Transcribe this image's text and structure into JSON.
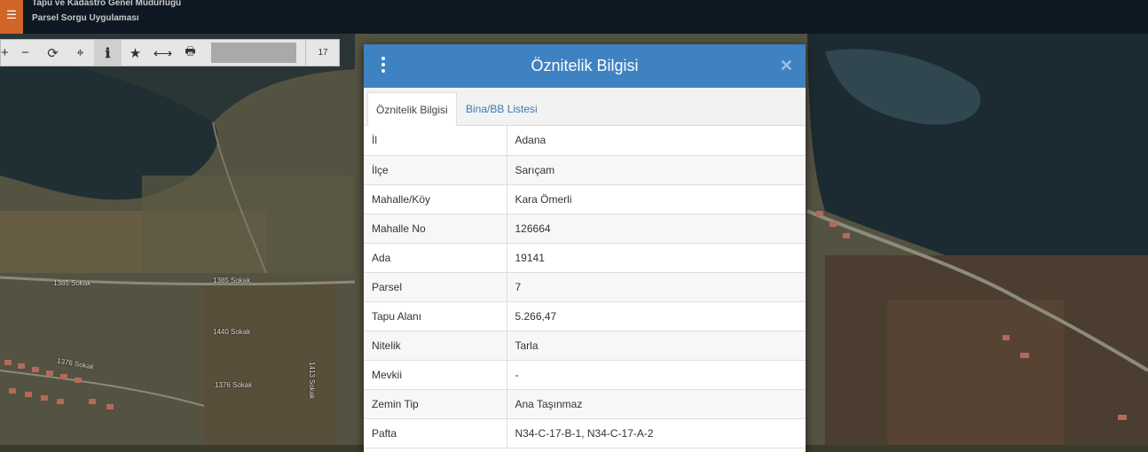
{
  "header": {
    "menu_icon": "hamburger-icon",
    "org_name": "Tapu ve Kadastro Genel Müdürlüğü",
    "app_name": "Parsel Sorgu Uygulaması"
  },
  "toolbar": {
    "tools": [
      {
        "name": "zoom-in-icon",
        "glyph": "+"
      },
      {
        "name": "zoom-out-icon",
        "glyph": "−"
      },
      {
        "name": "refresh-icon",
        "glyph": "⟳"
      },
      {
        "name": "locate-icon",
        "glyph": "⌖"
      },
      {
        "name": "info-icon",
        "glyph": "ℹ"
      },
      {
        "name": "star-icon",
        "glyph": "★"
      },
      {
        "name": "measure-icon",
        "glyph": "⟷"
      },
      {
        "name": "print-icon",
        "glyph": "🖶"
      }
    ],
    "zoom_level": "17"
  },
  "map": {
    "labels": [
      "1385 Sokak",
      "1385 Sokak",
      "1440 Sokak",
      "1376 Sokak",
      "1376 Sokak",
      "1413 Sokak"
    ]
  },
  "dialog": {
    "title": "Öznitelik Bilgisi",
    "close_icon": "close-icon",
    "tabs": [
      {
        "label": "Öznitelik Bilgisi",
        "active": true
      },
      {
        "label": "Bina/BB Listesi",
        "active": false
      }
    ],
    "rows": [
      {
        "key": "İl",
        "value": "Adana"
      },
      {
        "key": "İlçe",
        "value": "Sarıçam"
      },
      {
        "key": "Mahalle/Köy",
        "value": "Kara Ömerli"
      },
      {
        "key": "Mahalle No",
        "value": "126664"
      },
      {
        "key": "Ada",
        "value": "19141"
      },
      {
        "key": "Parsel",
        "value": "7"
      },
      {
        "key": "Tapu Alanı",
        "value": "5.266,47"
      },
      {
        "key": "Nitelik",
        "value": "Tarla"
      },
      {
        "key": "Mevkii",
        "value": "-"
      },
      {
        "key": "Zemin Tip",
        "value": "Ana Taşınmaz"
      },
      {
        "key": "Pafta",
        "value": "N34-C-17-B-1, N34-C-17-A-2"
      }
    ]
  },
  "colors": {
    "header_bg": "#0d1822",
    "menu_button": "#d1652a",
    "dialog_header": "#3e82c2",
    "tab_link": "#3a7ab8"
  }
}
